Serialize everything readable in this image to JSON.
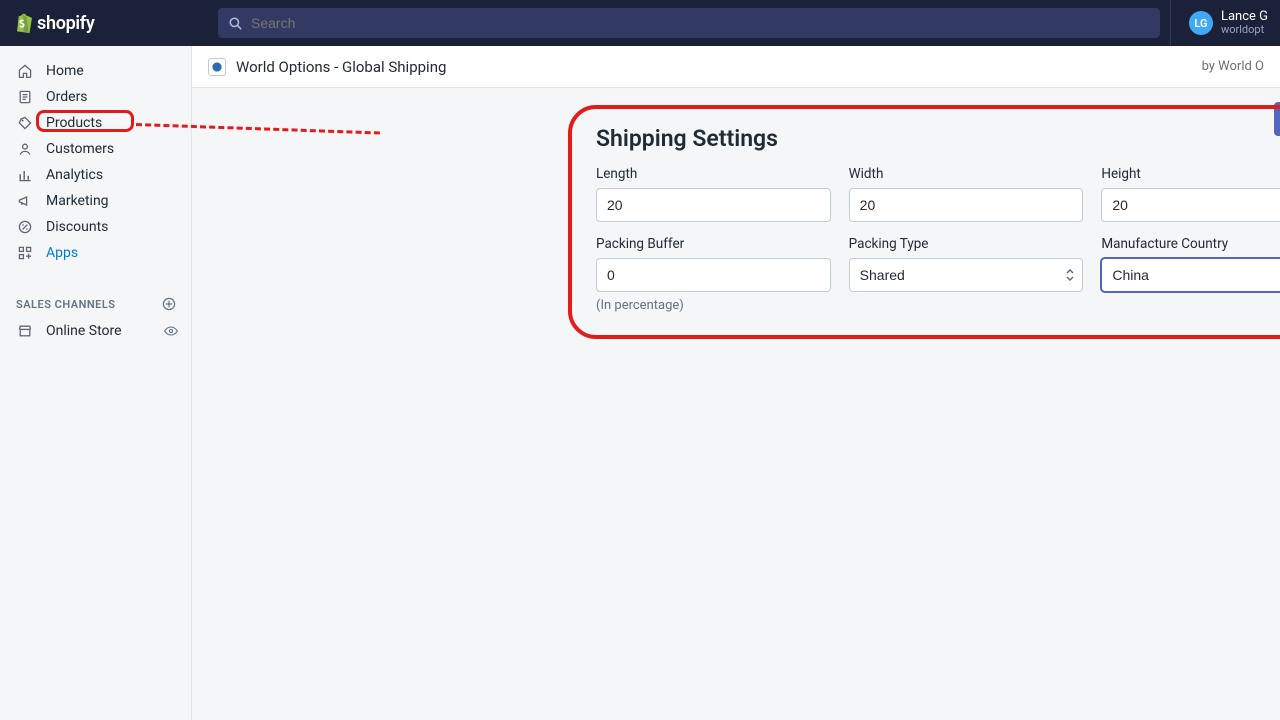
{
  "topbar": {
    "logo_text": "shopify",
    "search_placeholder": "Search",
    "user_initials": "LG",
    "user_name": "Lance G",
    "user_sub": "worldopt"
  },
  "sidebar": {
    "items": [
      {
        "label": "Home"
      },
      {
        "label": "Orders"
      },
      {
        "label": "Products"
      },
      {
        "label": "Customers"
      },
      {
        "label": "Analytics"
      },
      {
        "label": "Marketing"
      },
      {
        "label": "Discounts"
      },
      {
        "label": "Apps"
      }
    ],
    "section_header": "SALES CHANNELS",
    "channels": [
      {
        "label": "Online Store"
      }
    ]
  },
  "appbar": {
    "title": "World Options - Global Shipping",
    "by": "by World O"
  },
  "settings": {
    "title": "Shipping Settings",
    "length_label": "Length",
    "length_value": "20",
    "width_label": "Width",
    "width_value": "20",
    "height_label": "Height",
    "height_value": "20",
    "buffer_label": "Packing Buffer",
    "buffer_value": "0",
    "buffer_hint": "(In percentage)",
    "ptype_label": "Packing Type",
    "ptype_value": "Shared",
    "country_label": "Manufacture Country",
    "country_value": "China"
  }
}
